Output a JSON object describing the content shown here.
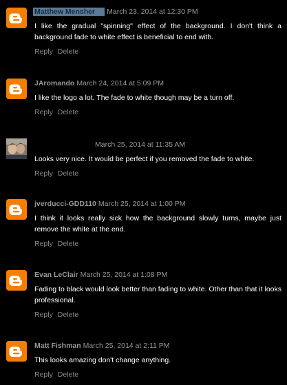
{
  "comments": [
    {
      "author": "Matthew Mensher",
      "date": "March 23, 2014 at 12:30 PM",
      "text": "I like the gradual \"spinning\" effect of the background. I don't think a background fade to white effect is beneficial to end with.",
      "reply_label": "Reply",
      "delete_label": "Delete",
      "avatar": "blogger-icon"
    },
    {
      "author": "JAromando",
      "date": "March 24, 2014 at 5:09 PM",
      "text": "I like the logo a lot. The fade to white though may be a turn off.",
      "reply_label": "Reply",
      "delete_label": "Delete",
      "avatar": "blogger-icon"
    },
    {
      "author": "",
      "date": "March 25, 2014 at 11:35 AM",
      "text": "Looks very nice. It would be perfect if you removed the fade to white.",
      "reply_label": "Reply",
      "delete_label": "Delete",
      "avatar": "user-photo"
    },
    {
      "author": "jverducci-GDD110",
      "date": "March 25, 2014 at 1:00 PM",
      "text": "I think it looks really sick how the background slowly turns, maybe just remove the white at the end.",
      "reply_label": "Reply",
      "delete_label": "Delete",
      "avatar": "blogger-icon"
    },
    {
      "author": "Evan LeClair",
      "date": "March 25, 2014 at 1:08 PM",
      "text": "Fading to black would look better than fading to white. Other than that it looks professional.",
      "reply_label": "Reply",
      "delete_label": "Delete",
      "avatar": "blogger-icon"
    },
    {
      "author": "Matt Fishman",
      "date": "March 25, 2014 at 2:11 PM",
      "text": "This looks amazing don't change anything.",
      "reply_label": "Reply",
      "delete_label": "Delete",
      "avatar": "blogger-icon"
    }
  ],
  "colors": {
    "background": "#000000",
    "blogger_orange": "#f57d00",
    "meta_text": "#999999",
    "body_text": "#ffffff",
    "selection": "#5b7a98"
  }
}
